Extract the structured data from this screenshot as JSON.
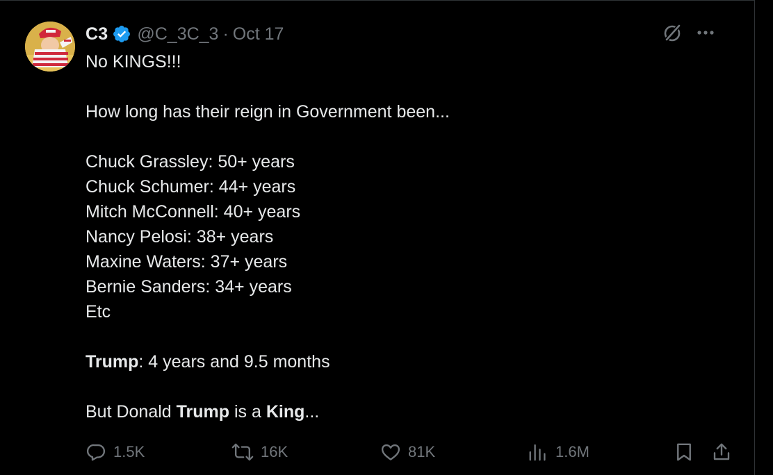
{
  "post": {
    "author": {
      "name": "C3",
      "handle": "@C_3C_3",
      "separator": "·",
      "date": "Oct 17"
    },
    "lines": {
      "l1": "No KINGS!!!",
      "l2": "How long has their reign in Government been...",
      "l3": "Chuck Grassley: 50+ years",
      "l4": "Chuck Schumer: 44+ years",
      "l5": "Mitch McConnell: 40+ years",
      "l6": "Nancy Pelosi: 38+ years",
      "l7": "Maxine Waters: 37+ years",
      "l8": "Bernie Sanders: 34+ years",
      "l9": "Etc",
      "trump_label": "Trump",
      "trump_rest": ": 4 years and 9.5 months",
      "last_a": "But Donald ",
      "last_b": "Trump",
      "last_c": " is a ",
      "last_d": "King",
      "last_e": "..."
    },
    "stats": {
      "replies": "1.5K",
      "reposts": "16K",
      "likes": "81K",
      "views": "1.6M"
    }
  },
  "colors": {
    "background": "#000000",
    "text": "#e7e9ea",
    "muted": "#71767b",
    "verified": "#1d9bf0"
  },
  "icons": [
    "grok-icon",
    "more-icon",
    "reply-icon",
    "repost-icon",
    "like-icon",
    "views-icon",
    "bookmark-icon",
    "share-icon"
  ]
}
